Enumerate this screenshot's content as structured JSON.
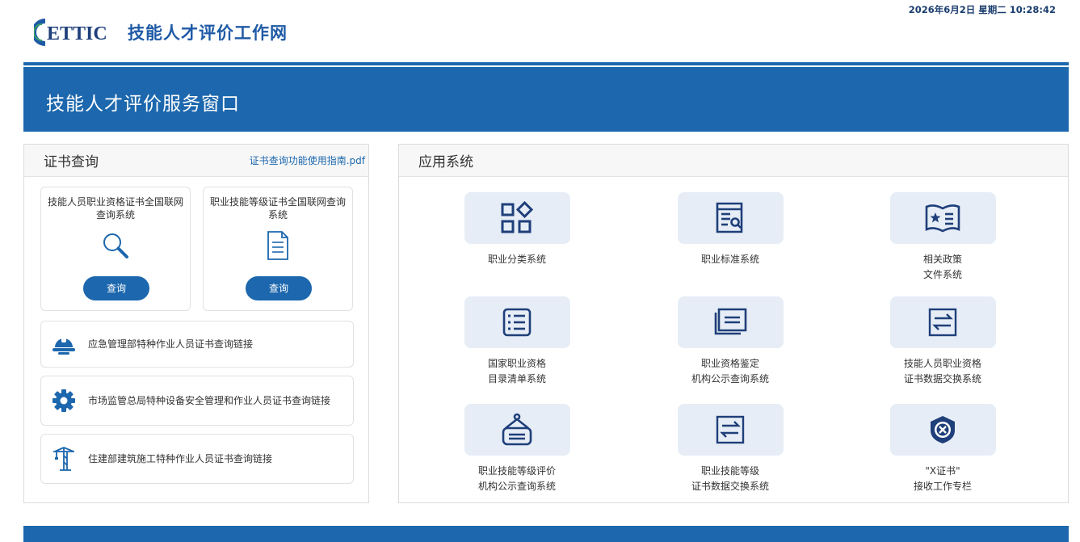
{
  "header": {
    "datetime": "2026年6月2日  星期二 10:28:42",
    "logo_text": "ETTIC",
    "site_title": "技能人才评价工作网",
    "brand_color": "#1c67ad"
  },
  "banner": {
    "title": "技能人才评价服务窗口"
  },
  "cert_query": {
    "title": "证书查询",
    "guide_link": "证书查询功能使用指南.pdf",
    "cards": [
      {
        "title": "技能人员职业资格证书全国联网查询系统",
        "icon": "magnifier-icon",
        "button": "查询"
      },
      {
        "title": "职业技能等级证书全国联网查询系统",
        "icon": "document-icon",
        "button": "查询"
      }
    ],
    "links": [
      {
        "label": "应急管理部特种作业人员证书查询链接",
        "icon": "helmet-icon"
      },
      {
        "label": "市场监管总局特种设备安全管理和作业人员证书查询链接",
        "icon": "gear-icon"
      },
      {
        "label": "住建部建筑施工特种作业人员证书查询链接",
        "icon": "crane-icon"
      }
    ]
  },
  "apps": {
    "title": "应用系统",
    "items": [
      {
        "label1": "职业分类系统",
        "label2": "",
        "icon": "category-grid-icon"
      },
      {
        "label1": "职业标准系统",
        "label2": "",
        "icon": "standard-search-icon"
      },
      {
        "label1": "相关政策",
        "label2": "文件系统",
        "icon": "policy-book-icon"
      },
      {
        "label1": "国家职业资格",
        "label2": "目录清单系统",
        "icon": "list-icon"
      },
      {
        "label1": "职业资格鉴定",
        "label2": "机构公示查询系统",
        "icon": "document-stack-icon"
      },
      {
        "label1": "技能人员职业资格",
        "label2": "证书数据交换系统",
        "icon": "exchange-icon"
      },
      {
        "label1": "职业技能等级评价",
        "label2": "机构公示查询系统",
        "icon": "signboard-icon"
      },
      {
        "label1": "职业技能等级",
        "label2": "证书数据交换系统",
        "icon": "exchange-icon"
      },
      {
        "label1": "\"X证书\"",
        "label2": "接收工作专栏",
        "icon": "x-badge-icon"
      }
    ]
  }
}
